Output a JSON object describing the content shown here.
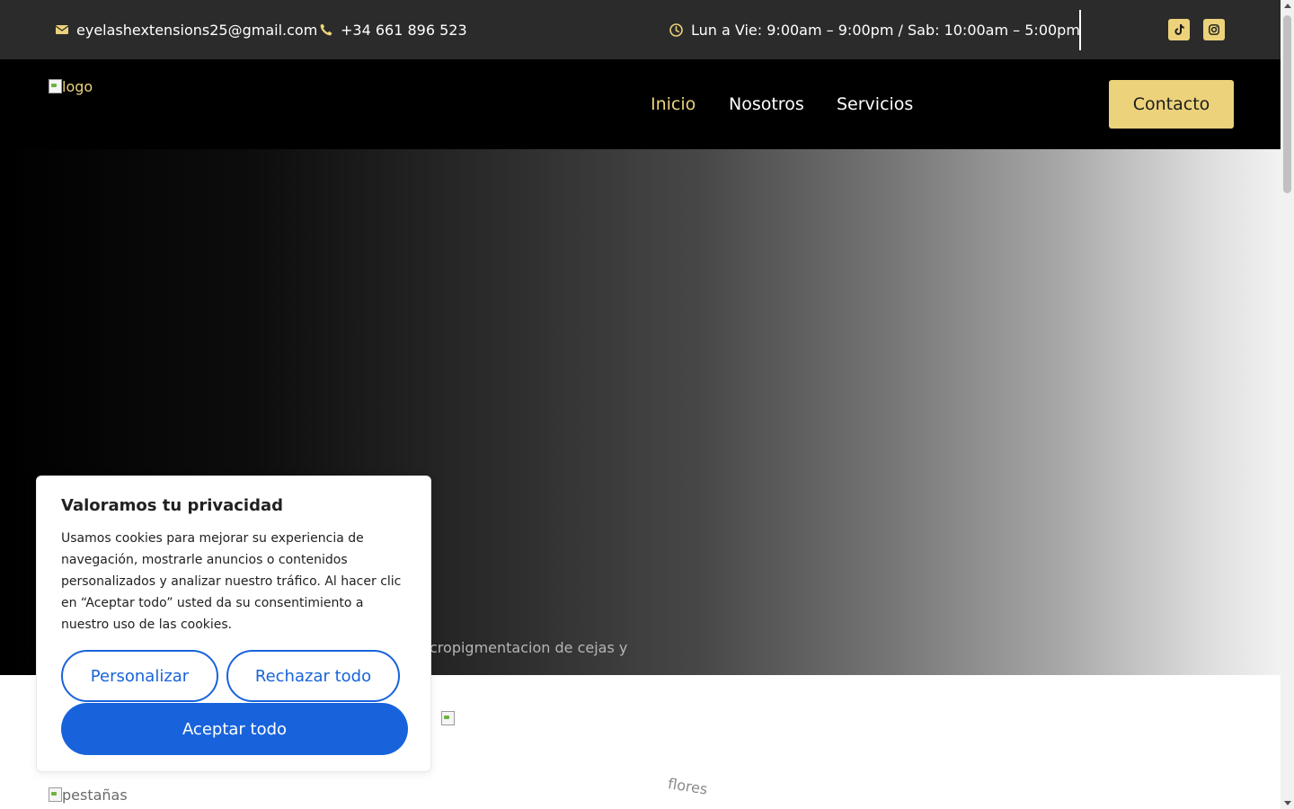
{
  "topbar": {
    "email": "eyelashextensions25@gmail.com",
    "phone": "+34 661 896 523",
    "hours": "Lun a Vie: 9:00am – 9:00pm / Sab: 10:00am – 5:00pm",
    "icons": [
      "envelope-icon",
      "phone-icon",
      "clock-icon",
      "tiktok-icon",
      "instagram-icon"
    ]
  },
  "header": {
    "logo_alt": "logo",
    "nav": [
      {
        "label": "Inicio",
        "active": true
      },
      {
        "label": "Nosotros",
        "active": false
      },
      {
        "label": "Servicios",
        "active": false
      }
    ],
    "cta_label": "Contacto"
  },
  "hero": {
    "text_fragment": "cropigmentacion de cejas y"
  },
  "content": {
    "image_alt_flores": "flores",
    "image_alt_pestanas": "pestañas"
  },
  "cookie": {
    "title": "Valoramos tu privacidad",
    "body": "Usamos cookies para mejorar su experiencia de navegación, mostrarle anuncios o contenidos personalizados y analizar nuestro tráfico. Al hacer clic en “Aceptar todo” usted da su consentimiento a nuestro uso de las cookies.",
    "customize_label": "Personalizar",
    "reject_label": "Rechazar todo",
    "accept_label": "Aceptar todo"
  },
  "colors": {
    "accent": "#ecd27a",
    "topbar_bg": "#2b2b2b",
    "header_bg": "#000000",
    "cookie_blue": "#1863dc"
  }
}
